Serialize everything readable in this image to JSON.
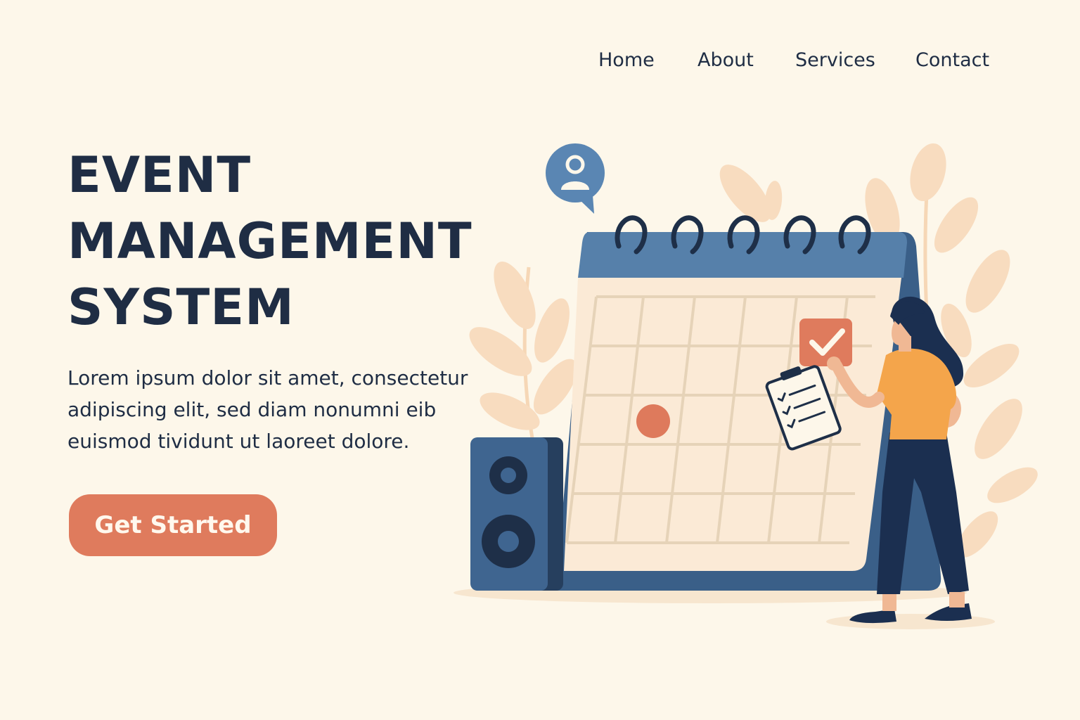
{
  "nav": {
    "home": "Home",
    "about": "About",
    "services": "Services",
    "contact": "Contact"
  },
  "hero": {
    "title_line1": "EVENT",
    "title_line2": "MANAGEMENT",
    "title_line3": "SYSTEM",
    "description": "Lorem ipsum dolor sit amet, consectetur adipiscing elit, sed diam nonumni eib euismod tividunt ut laoreet dolore.",
    "cta_label": "Get Started"
  },
  "colors": {
    "background": "#fdf7ea",
    "text": "#1f2d44",
    "accent": "#df7b5d",
    "calendar_blue": "#4f76a0",
    "leaf": "#f7d9b8",
    "shirt": "#f4a54b"
  },
  "icons": {
    "user_bubble": "user-chat-bubble-icon",
    "check": "check-icon",
    "clipboard": "clipboard-checklist-icon"
  }
}
